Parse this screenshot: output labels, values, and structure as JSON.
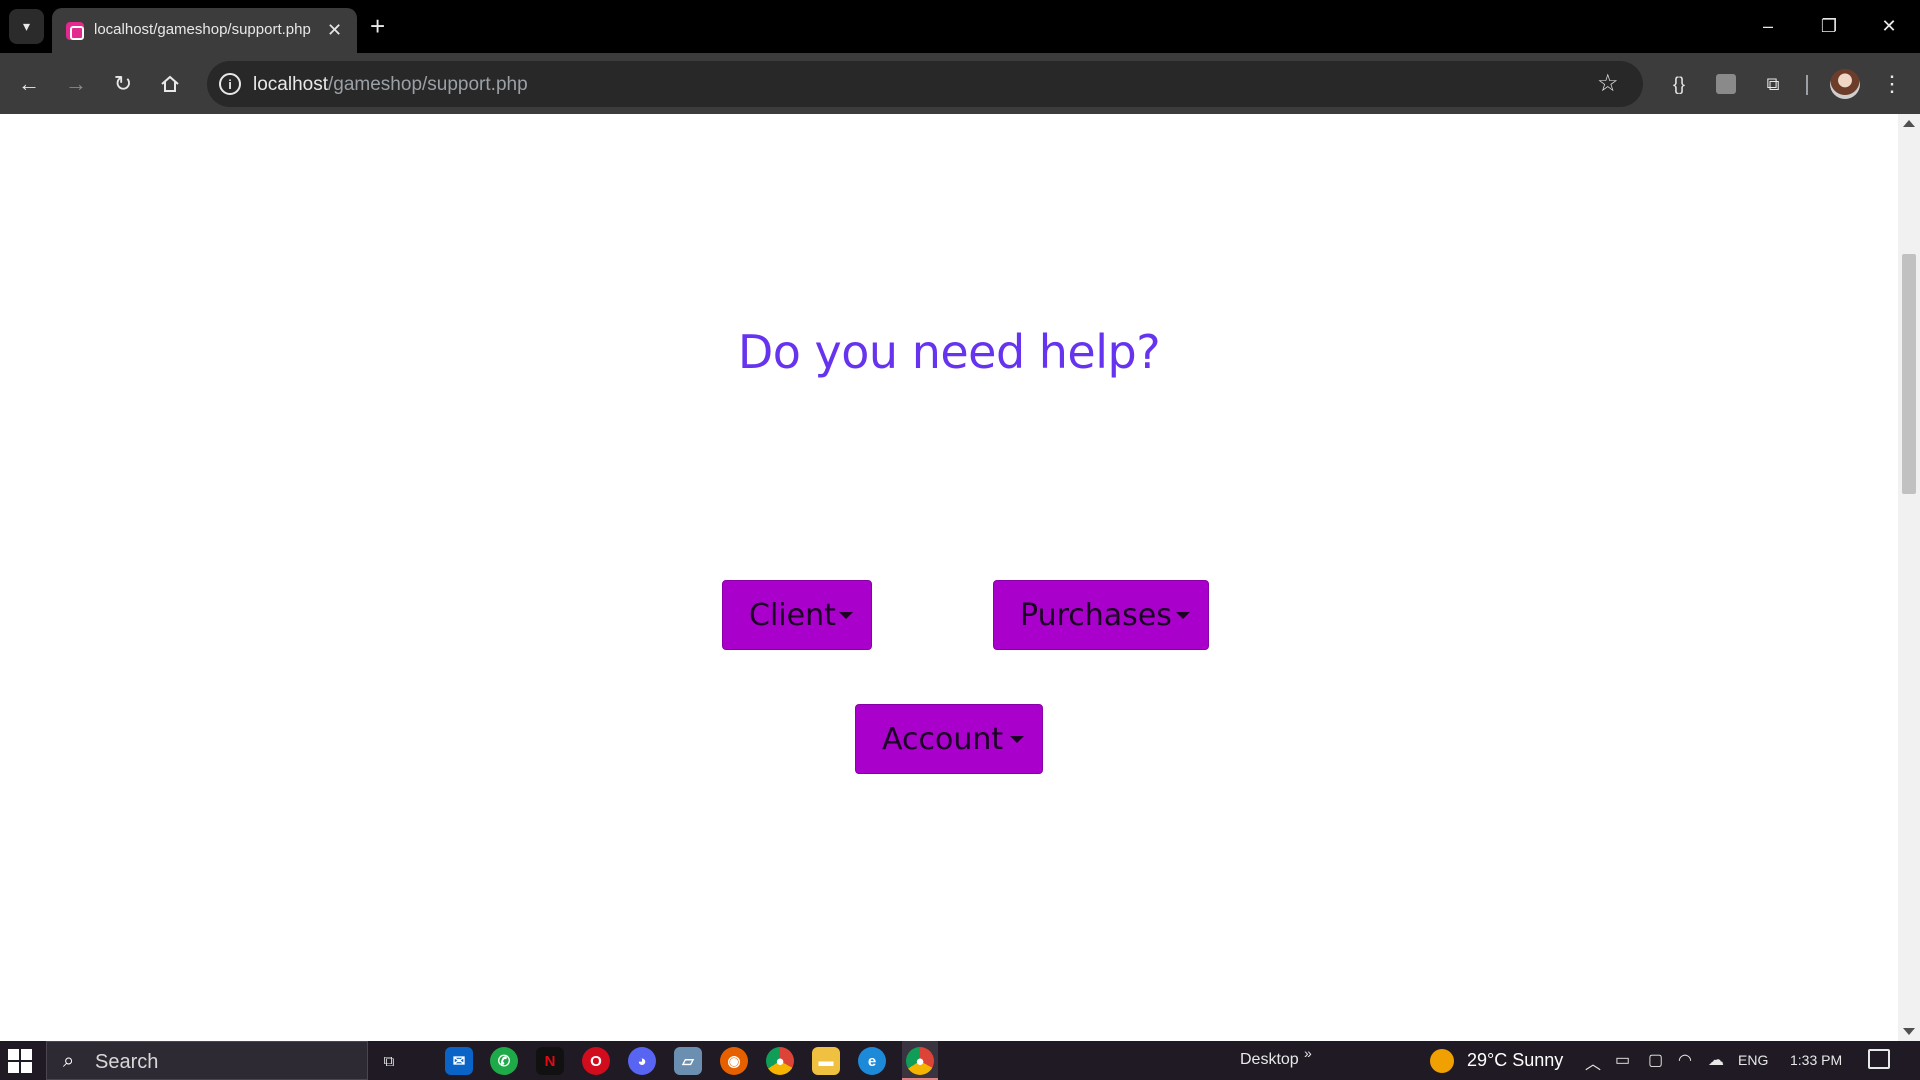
{
  "browser": {
    "tab_title": "localhost/gameshop/support.php",
    "tab_close": "✕",
    "new_tab": "+",
    "url_host": "localhost",
    "url_path": "/gameshop/support.php",
    "window_controls": {
      "minimize": "–",
      "restore": "❐",
      "close": "✕"
    }
  },
  "page": {
    "heading": "Do you need help?",
    "heading_color": "#6633ee",
    "button_color": "#aa00cc",
    "dropdowns": [
      {
        "label": "Client"
      },
      {
        "label": "Purchases"
      },
      {
        "label": "Account"
      }
    ]
  },
  "taskbar": {
    "search_label": "Search",
    "desktop_label": "Desktop",
    "weather": "29°C  Sunny",
    "language": "ENG",
    "time": "1:33 PM",
    "apps": [
      "task-view",
      "mail",
      "whatsapp",
      "netflix",
      "opera",
      "discord",
      "files-app",
      "firefox",
      "chrome",
      "file-explorer",
      "edge",
      "chrome-active"
    ]
  }
}
